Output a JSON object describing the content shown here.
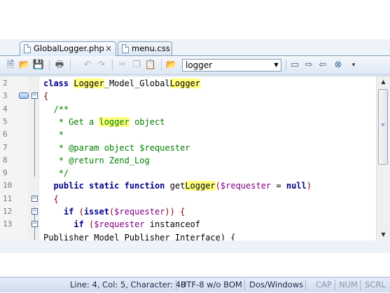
{
  "tabs": [
    {
      "label": "GlobalLogger.php",
      "close": "×",
      "active": true
    },
    {
      "label": "menu.css",
      "active": false
    }
  ],
  "toolbar": {
    "search_value": "logger",
    "icons": [
      "new-file-icon",
      "open-folder-icon",
      "save-icon",
      "print-icon",
      "undo-icon",
      "redo-icon",
      "cut-icon",
      "copy-icon",
      "paste-icon",
      "open-folder-icon",
      "bookmark-icon",
      "bookmark-next-icon",
      "bookmark-prev-icon",
      "bookmark-clear-icon"
    ]
  },
  "editor": {
    "lines": [
      {
        "n": "2"
      },
      {
        "n": "3"
      },
      {
        "n": "4"
      },
      {
        "n": "5"
      },
      {
        "n": "6"
      },
      {
        "n": "7"
      },
      {
        "n": "8"
      },
      {
        "n": "9"
      },
      {
        "n": "10"
      },
      {
        "n": "11"
      },
      {
        "n": "12"
      },
      {
        "n": "13"
      }
    ],
    "code": {
      "l2_class": "class",
      "l2_name_a": "Logger",
      "l2_name_b": "_Model_Global",
      "l2_name_c": "Logger",
      "l3": "{",
      "l4": "/**",
      "l5_a": "* Get a ",
      "l5_b": "logger",
      "l5_c": " object",
      "l6": "*",
      "l7": "* @param object $requester",
      "l8": "* @return Zend_Log",
      "l9": "*/",
      "l10_kw": "public static function",
      "l10_fn": " get",
      "l10_hl": "Logger",
      "l10_open": "(",
      "l10_var": "$requester",
      "l10_eq": " = ",
      "l10_null": "null",
      "l10_close": ")",
      "l11": "{",
      "l12_if": "if",
      "l12_open": " (",
      "l12_isset": "isset",
      "l12_rest": "(",
      "l12_var": "$requester",
      "l12_end": ")) {",
      "l13_if": "if",
      "l13_open": " (",
      "l13_var": "$requester",
      "l13_inst": " instanceof",
      "l14": "Publisher_Model_Publisher_Interface) {"
    }
  },
  "status": {
    "position": "Line: 4, Col: 5, Character: 48",
    "encoding": "UTF-8 w/o BOM",
    "eol": "Dos/Windows",
    "cap": "CAP",
    "num": "NUM",
    "scrl": "SCRL"
  }
}
